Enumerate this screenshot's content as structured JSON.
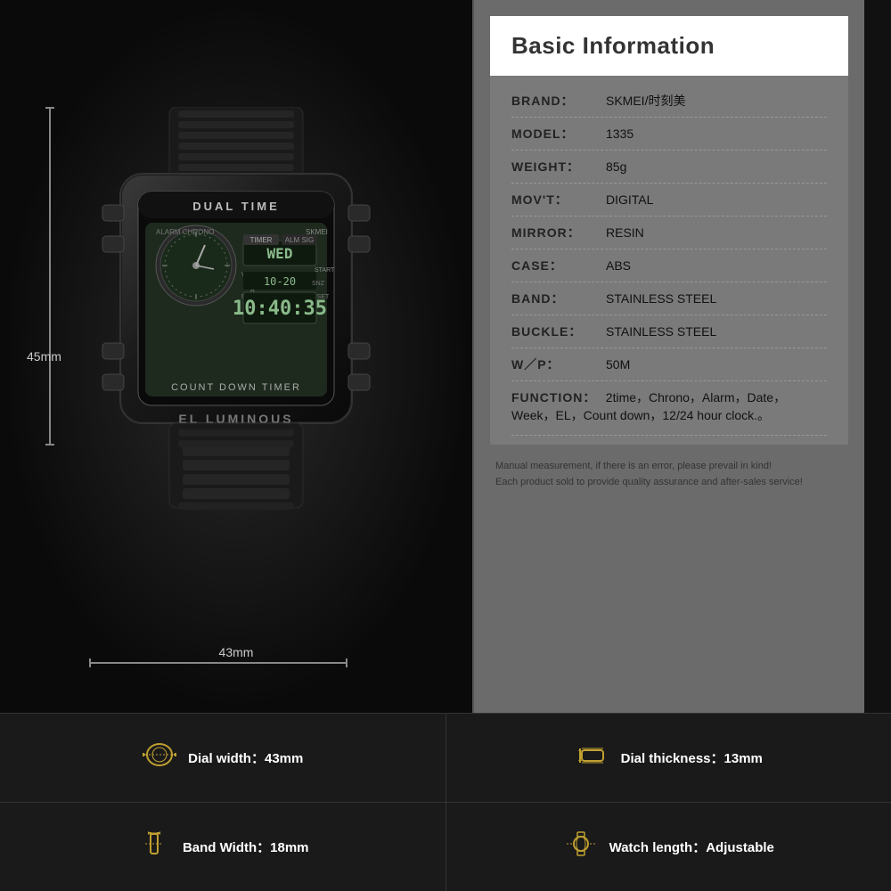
{
  "header": {
    "title": "Basic Information"
  },
  "info_rows": [
    {
      "key": "BRAND：",
      "value": "SKMEI/时刻美"
    },
    {
      "key": "MODEL：",
      "value": "1335"
    },
    {
      "key": "WEIGHT：",
      "value": "85g"
    },
    {
      "key": "MOV'T：",
      "value": "DIGITAL"
    },
    {
      "key": "MIRROR：",
      "value": "RESIN"
    },
    {
      "key": "CASE：",
      "value": "ABS"
    },
    {
      "key": "BAND：",
      "value": "STAINLESS STEEL"
    },
    {
      "key": "BUCKLE：",
      "value": "STAINLESS STEEL"
    },
    {
      "key": "W／P：",
      "value": "50M"
    }
  ],
  "function_key": "FUNCTION：",
  "function_val": "2time，Chrono，Alarm，Date，",
  "function_val2": "Week，EL，Count down，12/24 hour clock.。",
  "note_line1": "Manual measurement, if there is an error, please prevail in kind!",
  "note_line2": "Each product sold to provide quality assurance and after-sales service!",
  "dim_left": "45mm",
  "dim_bottom": "43mm",
  "bottom": {
    "row1": [
      {
        "icon": "⊙",
        "label_pre": "Dial width：",
        "label_val": "43mm"
      },
      {
        "icon": "⊓",
        "label_pre": "Dial thickness：",
        "label_val": "13mm"
      }
    ],
    "row2": [
      {
        "icon": "▯",
        "label_pre": "Band Width：",
        "label_val": "18mm"
      },
      {
        "icon": "⊃",
        "label_pre": "Watch length：",
        "label_val": "Adjustable"
      }
    ]
  }
}
